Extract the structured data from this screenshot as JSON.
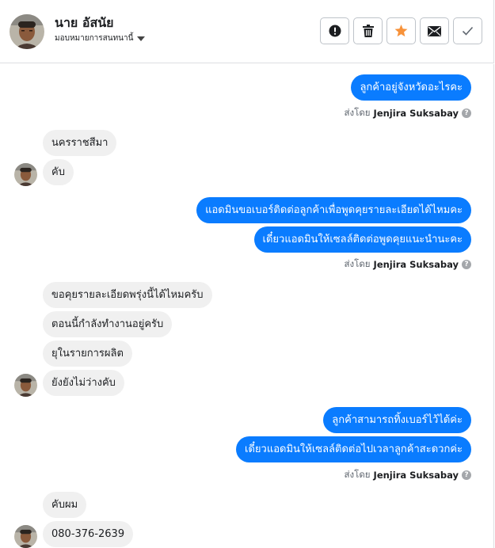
{
  "header": {
    "name": "นาย อัสนัย",
    "assign_label": "มอบหมายการสนทนานี้",
    "actions": [
      {
        "icon": "alert-icon",
        "label": "mark-spam"
      },
      {
        "icon": "trash-icon",
        "label": "delete"
      },
      {
        "icon": "star-icon",
        "label": "star",
        "color": "#f7923a"
      },
      {
        "icon": "mail-icon",
        "label": "mark-unread"
      },
      {
        "icon": "check-icon",
        "label": "done"
      }
    ]
  },
  "colors": {
    "outgoing": "#0a7cff",
    "incoming": "#f0f0f0",
    "star": "#f7923a"
  },
  "messages": {
    "m1": "ลูกค้าอยู่จังหวัดอะไรคะ",
    "m2": "นครราชสีมา",
    "m3": "คับ",
    "m4": "แอดมินขอเบอร์ติดต่อลูกค้าเพื่อพูดคุยรายละเอียดได้ไหมคะ",
    "m5": "เดี๋ยวแอดมินให้เซลล์ติดต่อพูดคุยแนะนำนะคะ",
    "m6": "ขอคุยรายละเอียดพรุ่งนี้ได้ไหมครับ",
    "m7": "ตอนนี้กำลังทำงานอยู่ครับ",
    "m8": "ยุในรายการผลิต",
    "m9": "ยังยังไม่ว่างคับ",
    "m10": "ลูกค้าสามารถทิ้งเบอร์ไว้ได้ค่ะ",
    "m11": "เดี๋ยวแอดมินให้เซลล์ติดต่อไปเวลาลูกค้าสะดวกค่ะ",
    "m12": "คับผม",
    "m13": "080-376-2639"
  },
  "sent_by": {
    "prefix": "ส่งโดย",
    "name": "Jenjira Suksabay",
    "help": "?"
  }
}
